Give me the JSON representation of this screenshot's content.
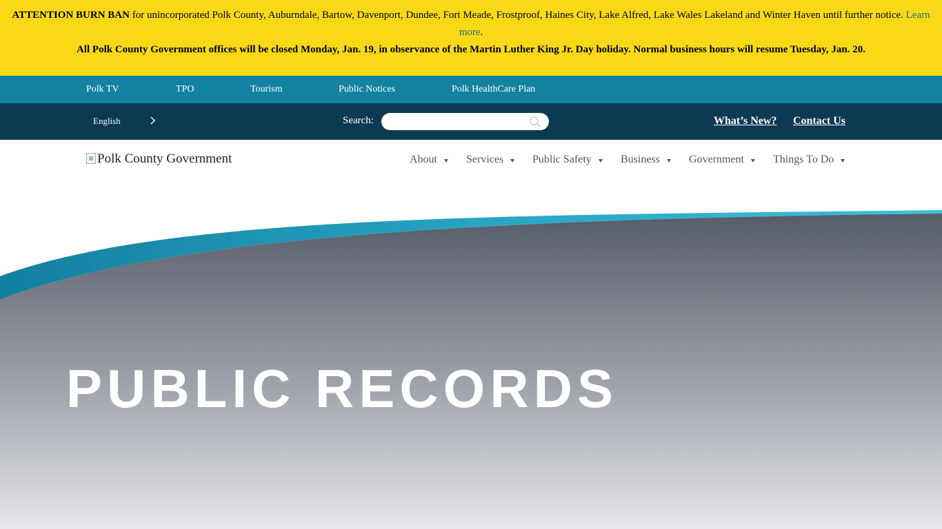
{
  "alert": {
    "burn_ban_title": "ATTENTION BURN BAN",
    "burn_ban_text": " for unincorporated Polk County, Auburndale, Bartow, Davenport, Dundee, Fort Meade, Frostproof, Haines City, Lake Alfred, Lake Wales Lakeland and Winter Haven until further notice. ",
    "learn_more": "Learn more",
    "learn_more_suffix": ".",
    "closure_notice": "All Polk County Government offices will be closed Monday, Jan. 19, in observance of the Martin Luther King Jr. Day holiday. Normal business hours will resume Tuesday, Jan. 20."
  },
  "utility_nav": {
    "items": [
      {
        "label": "Polk TV"
      },
      {
        "label": "TPO"
      },
      {
        "label": "Tourism"
      },
      {
        "label": "Public Notices"
      },
      {
        "label": "Polk HealthCare Plan"
      }
    ]
  },
  "search_bar": {
    "language": "English",
    "search_label": "Search:",
    "search_value": "",
    "whats_new": "What’s New?",
    "contact_us": "Contact Us"
  },
  "header": {
    "logo_alt": "Polk County Government",
    "nav": [
      {
        "label": "About"
      },
      {
        "label": "Services"
      },
      {
        "label": "Public Safety"
      },
      {
        "label": "Business"
      },
      {
        "label": "Government"
      },
      {
        "label": "Things To Do"
      }
    ]
  },
  "hero": {
    "title": "PUBLIC RECORDS"
  },
  "colors": {
    "alert_bg": "#f9d916",
    "utility_nav_bg": "#1382a0",
    "search_bar_bg": "#0c3a52",
    "hero_swoosh": "#2aa6c4",
    "hero_gradient_top": "#565c68",
    "hero_gradient_bottom": "#e6e7ea"
  },
  "icons": {
    "search": "search-icon",
    "language_chevron": "chevron-right-icon",
    "nav_caret": "caret-down-icon"
  }
}
